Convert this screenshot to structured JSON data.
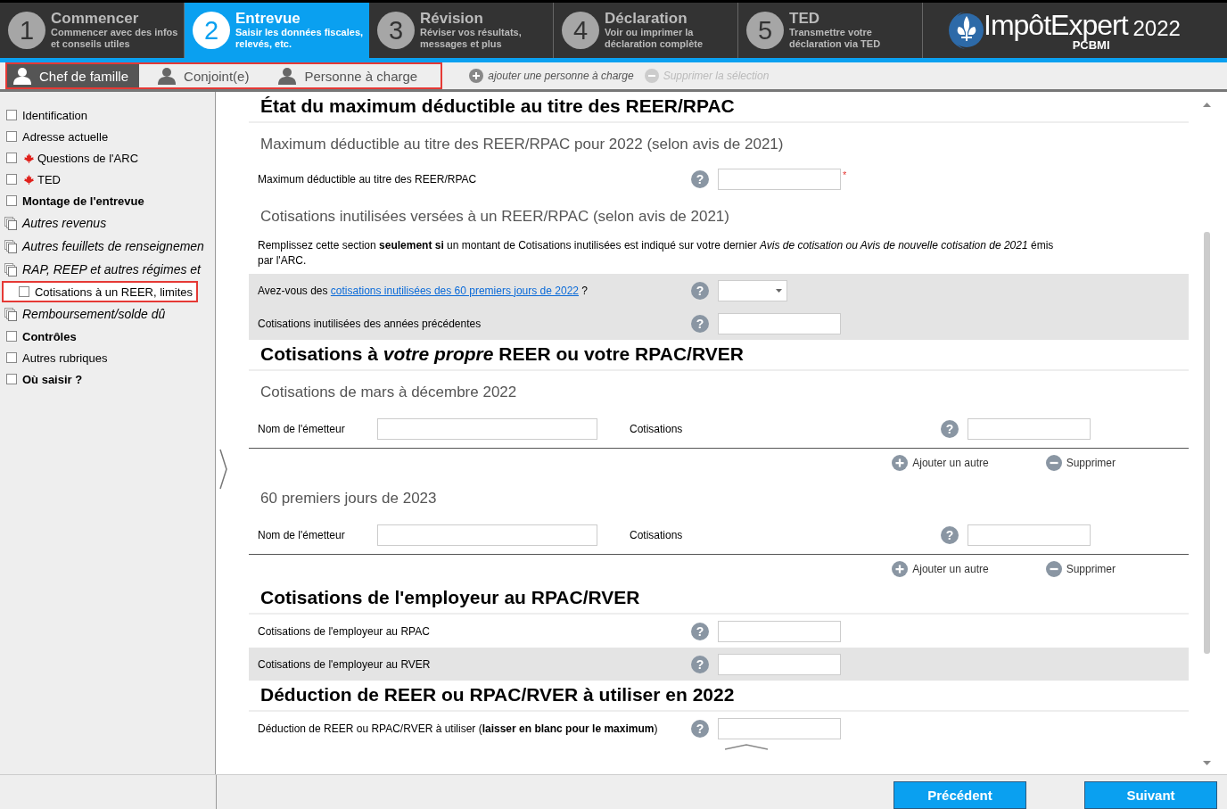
{
  "steps": [
    {
      "number": "1",
      "title": "Commencer",
      "subtitle": "Commencer avec des infos et conseils utiles",
      "selected": false
    },
    {
      "number": "2",
      "title": "Entrevue",
      "subtitle": "Saisir les données fiscales, relevés, etc.",
      "selected": true
    },
    {
      "number": "3",
      "title": "Révision",
      "subtitle": "Réviser vos résultats, messages et plus",
      "selected": false
    },
    {
      "number": "4",
      "title": "Déclaration",
      "subtitle": "Voir ou imprimer la déclaration complète",
      "selected": false
    },
    {
      "number": "5",
      "title": "TED",
      "subtitle": "Transmettre votre déclaration via TED",
      "selected": false
    }
  ],
  "logo": {
    "name": "ImpôtExpert",
    "sub": "PCBMI",
    "year": "2022"
  },
  "person_tabs": [
    {
      "label": "Chef de famille",
      "selected": true
    },
    {
      "label": "Conjoint(e)",
      "selected": false
    },
    {
      "label": "Personne à charge",
      "selected": false
    }
  ],
  "person_actions": [
    {
      "label": "ajouter une personne à charge",
      "disabled": false
    },
    {
      "label": "Supprimer la sélection",
      "disabled": true
    }
  ],
  "sidebar": {
    "items": [
      {
        "label": "Identification",
        "kind": "checkbox",
        "bold": false,
        "selected": false
      },
      {
        "label": "Adresse actuelle",
        "kind": "checkbox",
        "bold": false,
        "selected": false
      },
      {
        "label": "Questions de l'ARC",
        "kind": "flag",
        "bold": false,
        "selected": false
      },
      {
        "label": "TED",
        "kind": "flag",
        "bold": false,
        "selected": false
      },
      {
        "label": "Montage de l'entrevue",
        "kind": "checkbox",
        "bold": true,
        "selected": false
      },
      {
        "label": "Autres revenus",
        "kind": "copies",
        "bold": false,
        "selected": false
      },
      {
        "label": "Autres feuillets de renseignemen",
        "kind": "copies",
        "bold": false,
        "selected": false
      },
      {
        "label": "RAP, REEP et autres régimes et",
        "kind": "copies",
        "bold": false,
        "selected": false
      },
      {
        "label": "Cotisations à un REER, limites",
        "kind": "checkbox",
        "bold": false,
        "selected": true
      },
      {
        "label": "Remboursement/solde dû",
        "kind": "copies",
        "bold": false,
        "selected": false
      },
      {
        "label": "Contrôles",
        "kind": "checkbox",
        "bold": true,
        "selected": false
      },
      {
        "label": "Autres rubriques",
        "kind": "checkbox",
        "bold": false,
        "selected": false
      },
      {
        "label": "Où saisir ?",
        "kind": "checkbox",
        "bold": true,
        "selected": false
      }
    ]
  },
  "sections": [
    {
      "title": "État du maximum déductible au titre des REER/RPAC",
      "blocks": [
        {
          "kind": "subheading",
          "text": "Maximum déductible au titre des REER/RPAC pour 2022 (selon avis de 2021)"
        },
        {
          "kind": "field",
          "label": "Maximum déductible au titre des REER/RPAC",
          "help": "?",
          "dropdown": false,
          "required_mark": "*",
          "shaded": false
        },
        {
          "kind": "subheading",
          "text": "Cotisations inutilisées versées à un REER/RPAC (selon avis de 2021)"
        },
        {
          "kind": "note",
          "text": "Remplissez cette section **seulement si** un montant de Cotisations inutilisées est indiqué sur votre dernier *Avis de cotisation ou Avis de nouvelle cotisation de 2021* émis par l'ARC."
        },
        {
          "kind": "field",
          "label": "Avez-vous des ",
          "link": "cotisations inutilisées des 60 premiers jours de 2022",
          "label_after": " ?",
          "help": "?",
          "dropdown": true,
          "shaded": true
        },
        {
          "kind": "field",
          "label": "Cotisations inutilisées des années précédentes",
          "help": "?",
          "dropdown": false,
          "shaded": true
        }
      ]
    },
    {
      "title": "Cotisations à *votre propre* REER ou votre RPAC/RVER",
      "blocks": [
        {
          "kind": "subheading",
          "text": "Cotisations de mars à décembre 2022"
        },
        {
          "kind": "issuer",
          "issuer_label": "Nom de l'émetteur",
          "amount_label": "Cotisations",
          "help": "?"
        },
        {
          "kind": "actions",
          "add": "Ajouter un autre",
          "remove": "Supprimer"
        },
        {
          "kind": "subheading",
          "text": "60 premiers jours de 2023"
        },
        {
          "kind": "issuer",
          "issuer_label": "Nom de l'émetteur",
          "amount_label": "Cotisations",
          "help": "?"
        },
        {
          "kind": "actions",
          "add": "Ajouter un autre",
          "remove": "Supprimer"
        }
      ]
    },
    {
      "title": "Cotisations de l'employeur au RPAC/RVER",
      "blocks": [
        {
          "kind": "field",
          "label": "Cotisations de l'employeur au RPAC",
          "help": "?",
          "dropdown": false,
          "shaded": false
        },
        {
          "kind": "field",
          "label": "Cotisations de l'employeur au RVER",
          "help": "?",
          "dropdown": false,
          "shaded": true
        }
      ]
    },
    {
      "title": "Déduction de REER ou RPAC/RVER à utiliser en 2022",
      "blocks": [
        {
          "kind": "field",
          "label": "Déduction de REER ou RPAC/RVER à utiliser (**laisser en blanc pour le maximum**)",
          "help": "?",
          "dropdown": false,
          "shaded": false
        }
      ]
    }
  ],
  "footer": {
    "buttons": [
      "Précédent",
      "Suivant"
    ]
  }
}
